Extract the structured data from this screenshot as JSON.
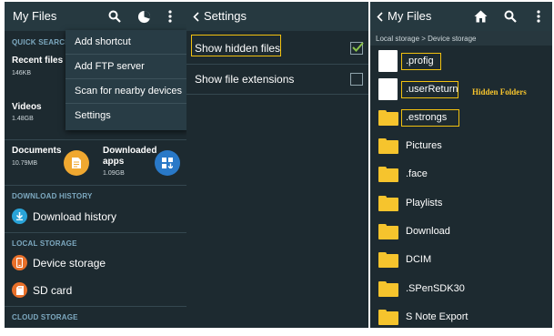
{
  "panel1": {
    "title": "My Files",
    "sections": {
      "quick_search": "QUICK SEARCH",
      "download_history": "DOWNLOAD HISTORY",
      "local_storage": "LOCAL STORAGE",
      "cloud_storage": "CLOUD STORAGE"
    },
    "tiles": {
      "recent": {
        "title": "Recent files",
        "size": "146KB"
      },
      "videos": {
        "title": "Videos",
        "size": "1.48GB"
      },
      "documents": {
        "title": "Documents",
        "size": "10.79MB"
      },
      "downloaded": {
        "title_line1": "Downloaded",
        "title_line2": "apps",
        "size": "1.09GB"
      }
    },
    "download_history": "Download history",
    "device_storage": "Device storage",
    "sd_card": "SD card",
    "menu": [
      "Add shortcut",
      "Add FTP server",
      "Scan for nearby devices",
      "Settings"
    ]
  },
  "panel2": {
    "title": "Settings",
    "show_hidden": {
      "label": "Show hidden files",
      "checked": true
    },
    "show_extensions": {
      "label": "Show file extensions",
      "checked": false
    }
  },
  "panel3": {
    "title": "My Files",
    "breadcrumb": "Local storage > Device storage",
    "hidden_note": "Hidden Folders",
    "items": [
      {
        "name": ".profig",
        "kind": "file",
        "highlight": true
      },
      {
        "name": ".userReturn",
        "kind": "file",
        "highlight": true
      },
      {
        "name": ".estrongs",
        "kind": "folder",
        "highlight": true
      },
      {
        "name": "Pictures",
        "kind": "folder",
        "highlight": false
      },
      {
        "name": ".face",
        "kind": "folder",
        "highlight": false
      },
      {
        "name": "Playlists",
        "kind": "folder",
        "highlight": false
      },
      {
        "name": "Download",
        "kind": "folder",
        "highlight": false
      },
      {
        "name": "DCIM",
        "kind": "folder",
        "highlight": false
      },
      {
        "name": ".SPenSDK30",
        "kind": "folder",
        "highlight": false
      },
      {
        "name": "S Note Export",
        "kind": "folder",
        "highlight": false
      }
    ]
  },
  "colors": {
    "background": "#1d2a30",
    "appbar": "#263940",
    "accent_yellow": "#f2c10f",
    "folder_yellow": "#f6c42d",
    "section_label": "#7da9c0",
    "videos_icon": "#8e44ad",
    "documents_icon": "#f0a830",
    "downloaded_icon": "#2979c8",
    "download_history_icon": "#29a3d8",
    "storage_icon": "#e8702a"
  },
  "icons": [
    "search-icon",
    "storage-usage-icon",
    "more-vert-icon",
    "back-chevron-icon",
    "home-icon",
    "check-icon",
    "folder-icon",
    "file-icon",
    "download-icon",
    "phone-storage-icon",
    "sd-card-icon",
    "document-icon",
    "apps-grid-icon"
  ]
}
